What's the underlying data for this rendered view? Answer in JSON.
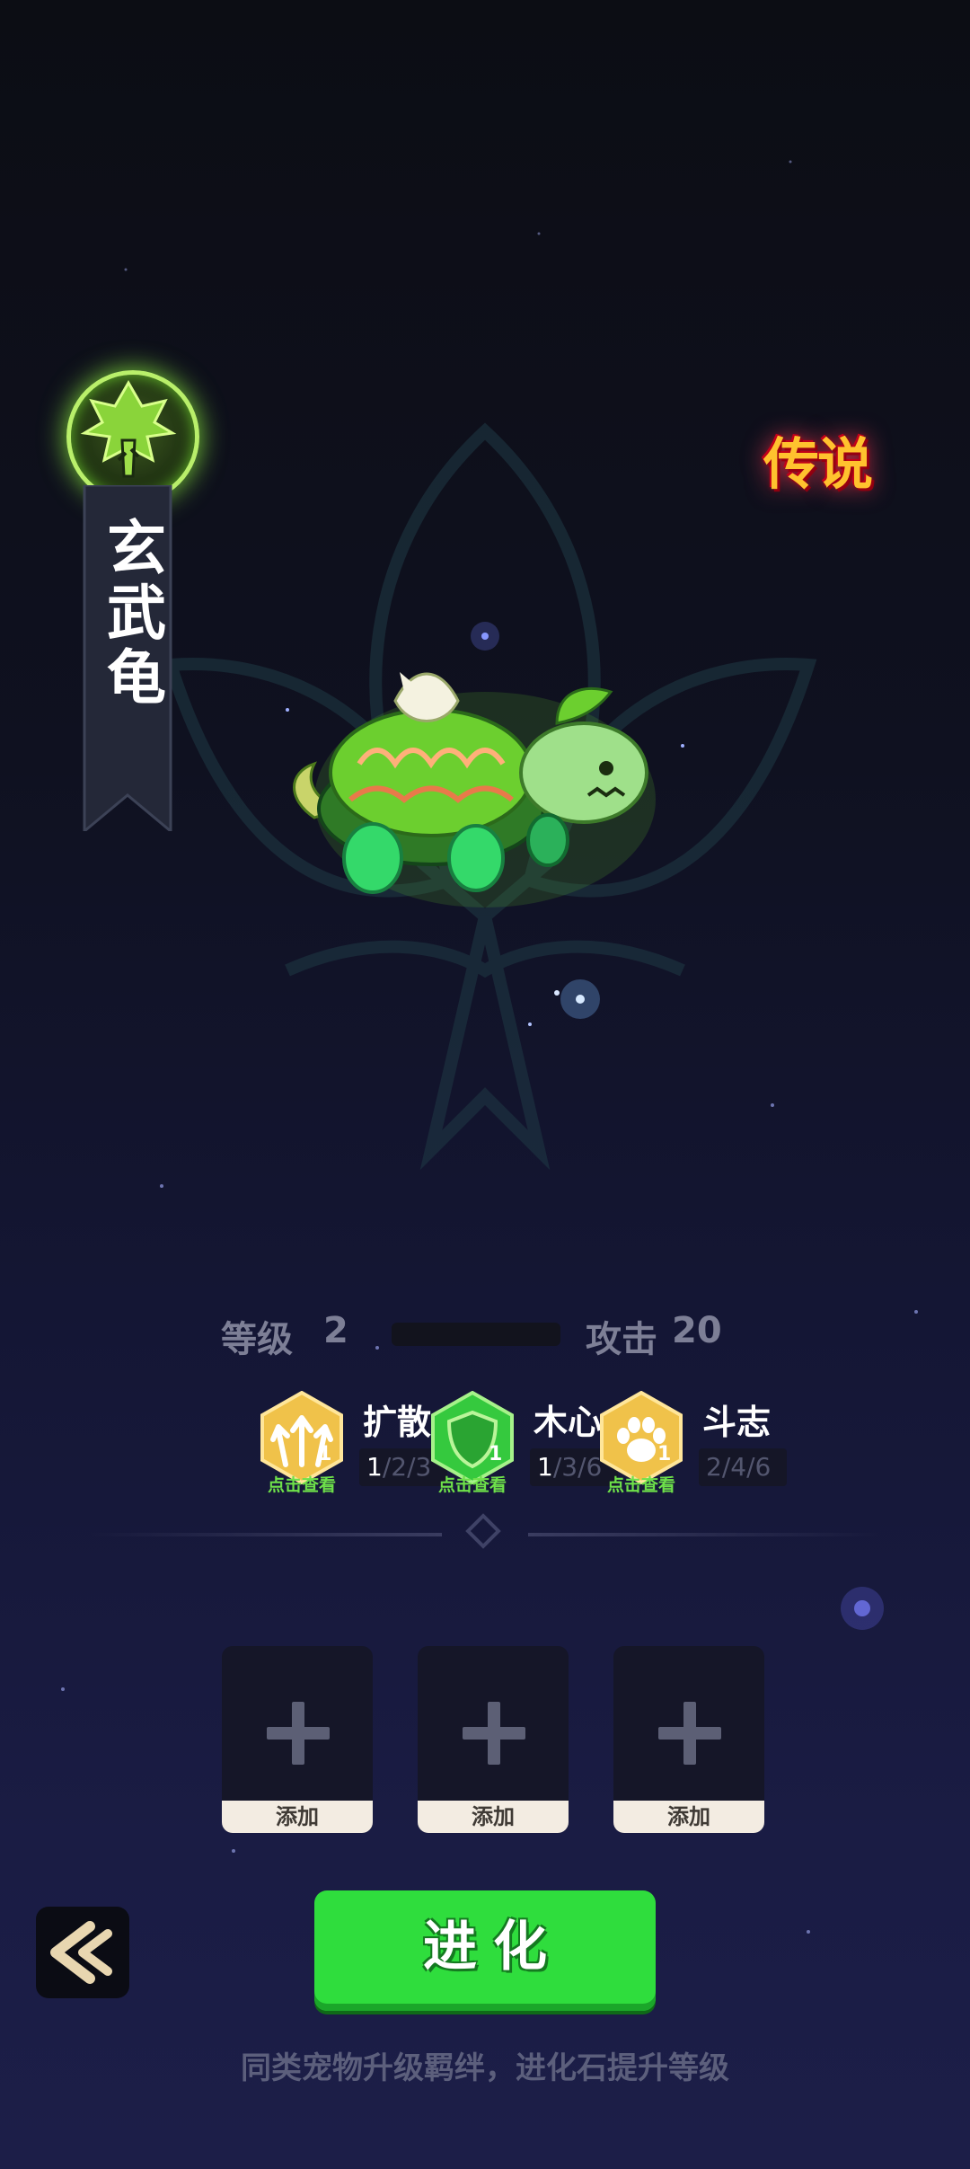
{
  "pet": {
    "name": "玄武龟",
    "rarity": "传说",
    "element_icon": "wood-element-icon"
  },
  "stats": {
    "level_label": "等级",
    "level_value": "2",
    "attack_label": "攻击",
    "attack_value": "20"
  },
  "skills": [
    {
      "name": "扩散",
      "count": "1",
      "hint": "点击查看",
      "tiers_current": "1",
      "tiers_rest": "/2/3",
      "icon": "arrows-spread-icon",
      "color": "#f0c24a"
    },
    {
      "name": "木心",
      "count": "1",
      "hint": "点击查看",
      "tiers_current": "1",
      "tiers_rest": "/3/6",
      "icon": "shield-icon",
      "color": "#35c93e"
    },
    {
      "name": "斗志",
      "count": "1",
      "hint": "点击查看",
      "tiers_current": "",
      "tiers_rest": "2/4/6",
      "icon": "paw-icon",
      "color": "#f0c24a"
    }
  ],
  "slots": [
    {
      "label": "添加"
    },
    {
      "label": "添加"
    },
    {
      "label": "添加"
    }
  ],
  "evolve_button": "进化",
  "footer_hint": "同类宠物升级羁绊，进化石提升等级",
  "colors": {
    "accent_green": "#2fdd3d",
    "rarity_gold": "#ffc22e",
    "element_glow": "#b9ef6a"
  }
}
